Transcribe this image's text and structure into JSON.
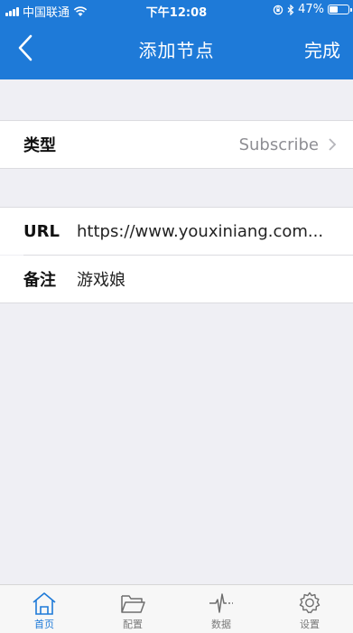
{
  "status_bar": {
    "carrier": "中国联通",
    "time": "下午12:08",
    "battery": "47%",
    "battery_level": 0.47
  },
  "nav": {
    "title": "添加节点",
    "done_label": "完成",
    "back_icon": "chevron-left-icon"
  },
  "form": {
    "type_label": "类型",
    "type_value": "Subscribe",
    "url_label": "URL",
    "url_value": "https://www.youxiniang.com...",
    "remark_label": "备注",
    "remark_value": "游戏娘"
  },
  "tabbar": {
    "items": [
      {
        "label": "首页",
        "icon": "home-icon",
        "active": true
      },
      {
        "label": "配置",
        "icon": "folder-icon",
        "active": false
      },
      {
        "label": "数据",
        "icon": "pulse-icon",
        "active": false
      },
      {
        "label": "设置",
        "icon": "gear-icon",
        "active": false
      }
    ]
  },
  "colors": {
    "accent": "#1e7ad8",
    "background": "#efeff4",
    "inactive_tab": "#7a7a7a"
  }
}
